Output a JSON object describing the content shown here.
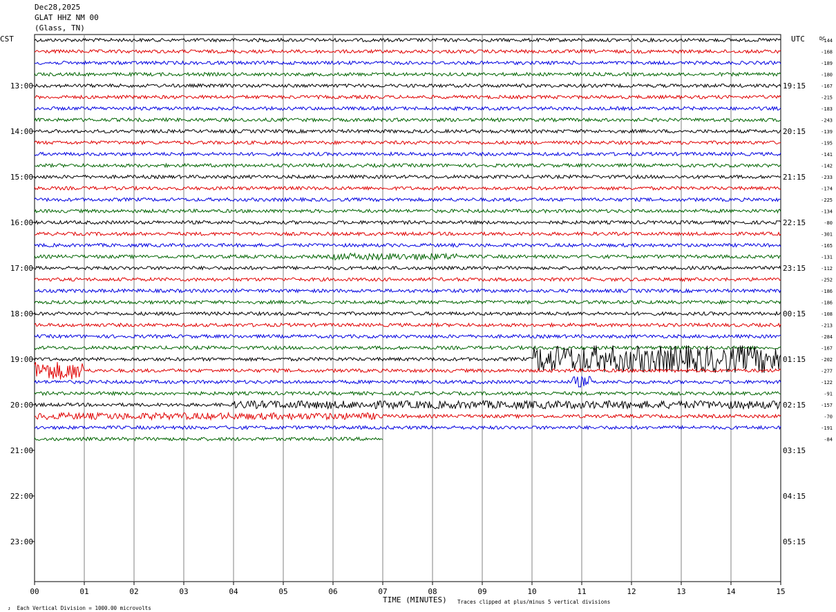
{
  "header": {
    "date": "Dec28,2025",
    "station": "GLAT HHZ NM 00",
    "location": "(Glass, TN)"
  },
  "corner_left": "CST",
  "corner_right": "UTC",
  "dc_label": "DC",
  "footer": {
    "vertical_division": "Each Vertical Division = 1000.00 microvolts",
    "clip_note": "Traces clipped at plus/minus 5 vertical divisions"
  },
  "colors": {
    "trace_cycle": [
      "#000000",
      "#e00000",
      "#0000e0",
      "#006400"
    ],
    "grid": "#808080"
  },
  "chart_data": {
    "type": "line",
    "xlabel": "TIME (MINUTES)",
    "x_ticks": [
      "00",
      "01",
      "02",
      "03",
      "04",
      "05",
      "06",
      "07",
      "08",
      "09",
      "10",
      "11",
      "12",
      "13",
      "14",
      "15"
    ],
    "xlim": [
      0,
      15
    ],
    "left_hour_labels": [
      "13:00",
      "14:00",
      "15:00",
      "16:00",
      "17:00",
      "18:00",
      "19:00",
      "20:00",
      "21:00",
      "22:00",
      "23:00"
    ],
    "right_hour_labels": [
      "19:15",
      "20:15",
      "21:15",
      "22:15",
      "23:15",
      "00:15",
      "01:15",
      "02:15",
      "03:15",
      "04:15",
      "05:15"
    ],
    "lines_per_hour": 4,
    "first_label_line_index": 4,
    "total_line_slots": 48,
    "dc_offsets": [
      "-144",
      "-168",
      "-189",
      "-180",
      "-167",
      "-215",
      "-183",
      "-243",
      "-139",
      "-195",
      "-141",
      "-142",
      "-233",
      "-174",
      "-225",
      "-134",
      "-80",
      "-301",
      "-165",
      "-131",
      "-112",
      "-252",
      "-186",
      "-186",
      "-108",
      "-213",
      "-284",
      "-167",
      "-202",
      "-277",
      "-122",
      "-91",
      "-157",
      "-70",
      "-191",
      "-84"
    ],
    "trace_lengths_minutes": [
      15,
      15,
      15,
      15,
      15,
      15,
      15,
      15,
      15,
      15,
      15,
      15,
      15,
      15,
      15,
      15,
      15,
      15,
      15,
      15,
      15,
      15,
      15,
      15,
      15,
      15,
      15,
      15,
      15,
      15,
      15,
      15,
      15,
      15,
      15,
      7
    ],
    "noise_amplitude_divisions": 0.15,
    "clip_divisions": 5,
    "events": [
      {
        "line": 19,
        "start_minute": 6.0,
        "end_minute": 8.5,
        "amplitude": 0.3
      },
      {
        "line": 28,
        "start_minute": 10.0,
        "end_minute": 15.0,
        "amplitude": 1.2
      },
      {
        "line": 29,
        "start_minute": 0.0,
        "end_minute": 1.0,
        "amplitude": 0.8
      },
      {
        "line": 30,
        "start_minute": 10.8,
        "end_minute": 11.2,
        "amplitude": 0.5
      },
      {
        "line": 32,
        "start_minute": 4.0,
        "end_minute": 15.0,
        "amplitude": 0.35
      },
      {
        "line": 33,
        "start_minute": 0.0,
        "end_minute": 7.0,
        "amplitude": 0.3
      }
    ]
  }
}
